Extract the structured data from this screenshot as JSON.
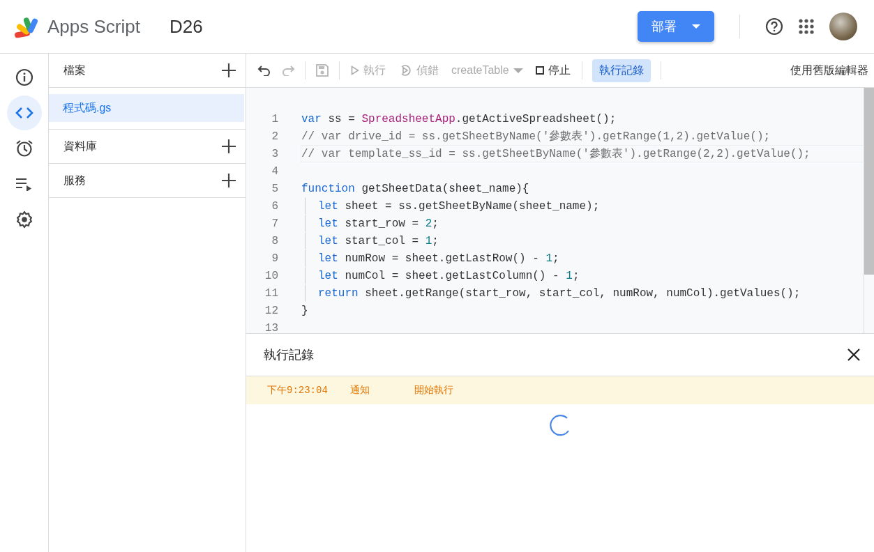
{
  "header": {
    "product": "Apps Script",
    "project": "D26",
    "deploy_button": "部署"
  },
  "rail": [
    {
      "kind": "info",
      "selected": false
    },
    {
      "kind": "code",
      "selected": true
    },
    {
      "kind": "triggers",
      "selected": false
    },
    {
      "kind": "executions",
      "selected": false
    },
    {
      "kind": "settings",
      "selected": false
    }
  ],
  "sidebar": {
    "sections": [
      {
        "title": "檔案",
        "files": [
          {
            "name": "程式碼.gs",
            "selected": true
          }
        ]
      },
      {
        "title": "資料庫"
      },
      {
        "title": "服務"
      }
    ]
  },
  "toolbar": {
    "items": [
      {
        "kind": "undo",
        "disabled": false
      },
      {
        "kind": "redo",
        "disabled": true
      },
      {
        "kind": "separator"
      },
      {
        "kind": "save",
        "disabled": true
      },
      {
        "kind": "separator"
      },
      {
        "kind": "run",
        "label": "執行",
        "disabled": true
      },
      {
        "kind": "debug",
        "label": "偵錯",
        "disabled": true
      },
      {
        "kind": "function-select",
        "label": "createTable",
        "disabled": true
      },
      {
        "kind": "stop",
        "label": "停止",
        "disabled": false
      },
      {
        "kind": "separator"
      },
      {
        "kind": "toggle",
        "label": "執行記錄",
        "selected": true
      },
      {
        "kind": "separator"
      }
    ],
    "legacy_link": "使用舊版編輯器"
  },
  "code": {
    "lines": [
      {
        "number": "1",
        "current": false,
        "indented": false,
        "tokens": [
          {
            "kind": "keyword",
            "text": "var"
          },
          {
            "kind": "plain",
            "text": " ss = "
          },
          {
            "kind": "class",
            "text": "SpreadsheetApp"
          },
          {
            "kind": "plain",
            "text": ".getActiveSpreadsheet();"
          }
        ]
      },
      {
        "number": "2",
        "current": false,
        "indented": false,
        "tokens": [
          {
            "kind": "comment",
            "text": "// var drive_id = ss.getSheetByName('參數表').getRange(1,2).getValue();"
          }
        ]
      },
      {
        "number": "3",
        "current": true,
        "indented": false,
        "tokens": [
          {
            "kind": "comment",
            "text": "// var template_ss_id = ss.getSheetByName('參數表').getRange(2,2).getValue();"
          }
        ]
      },
      {
        "number": "4",
        "current": false,
        "indented": false
      },
      {
        "number": "5",
        "current": false,
        "indented": false,
        "tokens": [
          {
            "kind": "keyword",
            "text": "function"
          },
          {
            "kind": "plain",
            "text": " getSheetData(sheet_name){"
          }
        ]
      },
      {
        "number": "6",
        "current": false,
        "indented": true,
        "tokens": [
          {
            "kind": "keyword",
            "text": "let"
          },
          {
            "kind": "plain",
            "text": " sheet = ss.getSheetByName(sheet_name);"
          }
        ]
      },
      {
        "number": "7",
        "current": false,
        "indented": true,
        "tokens": [
          {
            "kind": "keyword",
            "text": "let"
          },
          {
            "kind": "plain",
            "text": " start_row = "
          },
          {
            "kind": "number",
            "text": "2"
          },
          {
            "kind": "plain",
            "text": ";"
          }
        ]
      },
      {
        "number": "8",
        "current": false,
        "indented": true,
        "tokens": [
          {
            "kind": "keyword",
            "text": "let"
          },
          {
            "kind": "plain",
            "text": " start_col = "
          },
          {
            "kind": "number",
            "text": "1"
          },
          {
            "kind": "plain",
            "text": ";"
          }
        ]
      },
      {
        "number": "9",
        "current": false,
        "indented": true,
        "tokens": [
          {
            "kind": "keyword",
            "text": "let"
          },
          {
            "kind": "plain",
            "text": " numRow = sheet.getLastRow() - "
          },
          {
            "kind": "number",
            "text": "1"
          },
          {
            "kind": "plain",
            "text": ";"
          }
        ]
      },
      {
        "number": "10",
        "current": false,
        "indented": true,
        "tokens": [
          {
            "kind": "keyword",
            "text": "let"
          },
          {
            "kind": "plain",
            "text": " numCol = sheet.getLastColumn() - "
          },
          {
            "kind": "number",
            "text": "1"
          },
          {
            "kind": "plain",
            "text": ";"
          }
        ]
      },
      {
        "number": "11",
        "current": false,
        "indented": true,
        "tokens": [
          {
            "kind": "keyword",
            "text": "return"
          },
          {
            "kind": "plain",
            "text": " sheet.getRange(start_row, start_col, numRow, numCol).getValues();"
          }
        ]
      },
      {
        "number": "12",
        "current": false,
        "indented": false,
        "tokens": [
          {
            "kind": "plain",
            "text": "}"
          }
        ]
      },
      {
        "number": "13",
        "current": false,
        "indented": false
      }
    ]
  },
  "log_panel": {
    "title": "執行記錄",
    "entries": [
      {
        "time": "下午9:23:04",
        "level": "通知",
        "message": "開始執行"
      }
    ],
    "loading": true
  }
}
